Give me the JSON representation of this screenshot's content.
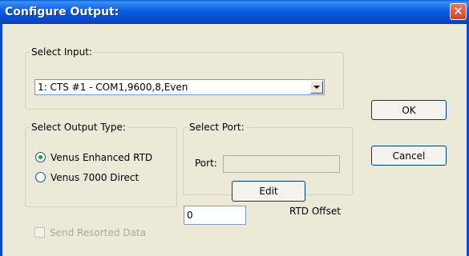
{
  "window": {
    "title": "Configure Output:",
    "close_icon": "close-icon"
  },
  "select_input": {
    "legend": "Select Input:",
    "selected_value": "1: CTS #1 - COM1,9600,8,Even"
  },
  "output_type": {
    "legend": "Select Output Type:",
    "options": [
      {
        "label": "Venus Enhanced RTD",
        "selected": true
      },
      {
        "label": "Venus 7000 Direct",
        "selected": false
      }
    ]
  },
  "port": {
    "legend": "Select Port:",
    "port_label": "Port:",
    "port_value": "",
    "edit_label": "Edit"
  },
  "rtd_offset": {
    "value": "0",
    "label": "RTD Offset"
  },
  "send_resorted": {
    "label": "Send Resorted Data",
    "checked": false,
    "enabled": false
  },
  "buttons": {
    "ok": "OK",
    "cancel": "Cancel"
  },
  "colors": {
    "titlebar": "#0b5ee0",
    "face": "#ece9d8",
    "close": "#d04425"
  }
}
